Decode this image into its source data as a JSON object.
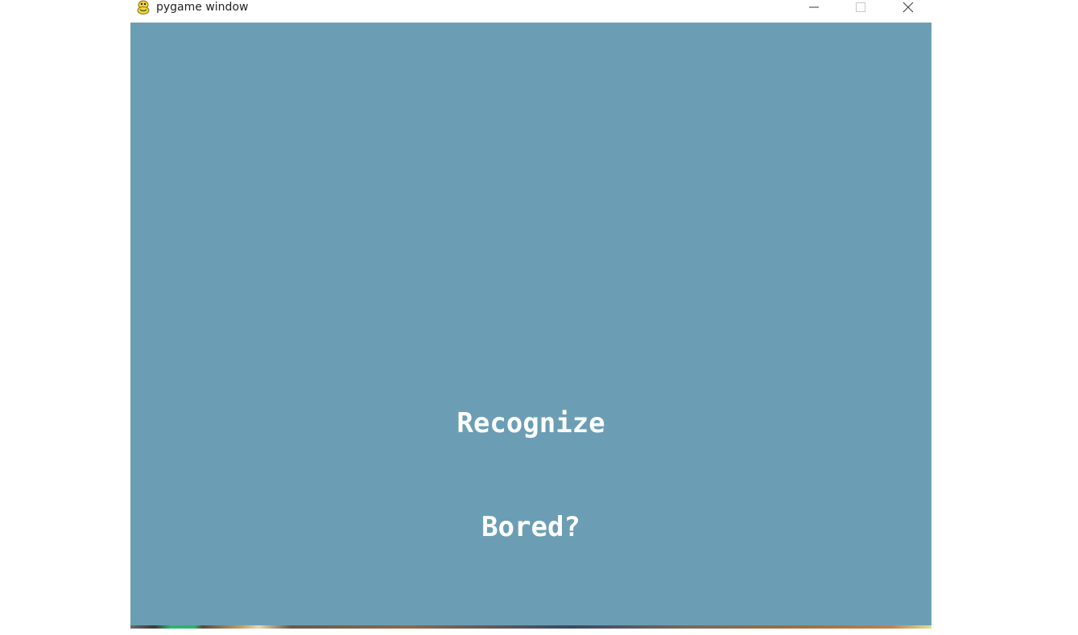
{
  "window": {
    "title": "pygame window",
    "app_icon": "pygame-snake-icon",
    "controls": {
      "minimize_icon": "minimize-icon",
      "maximize_icon": "maximize-icon",
      "close_icon": "close-icon"
    }
  },
  "canvas": {
    "background_color": "#6b9eb5",
    "text_color": "#ffffff"
  },
  "menu": {
    "items": [
      {
        "label": "Recognize"
      },
      {
        "label": "Bored?"
      }
    ]
  }
}
